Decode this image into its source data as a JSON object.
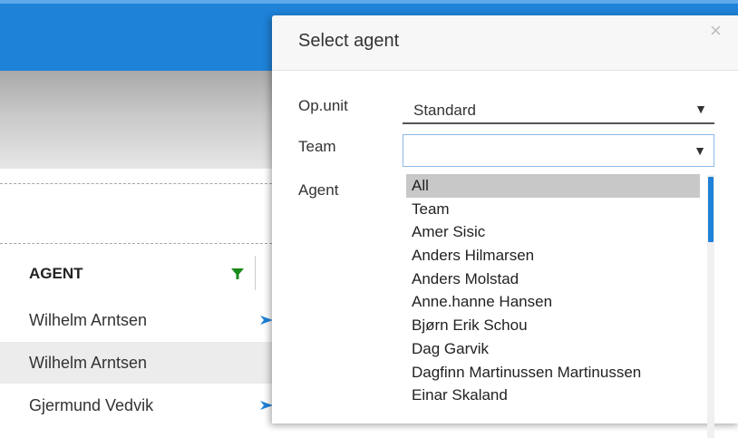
{
  "grid": {
    "column_header": "AGENT",
    "rows": [
      "Wilhelm Arntsen",
      "Wilhelm Arntsen",
      "Gjermund Vedvik"
    ]
  },
  "dialog": {
    "title": "Select agent",
    "close_symbol": "×",
    "fields": {
      "opunit_label": "Op.unit",
      "opunit_value": "Standard",
      "team_label": "Team",
      "team_value": "",
      "agent_label": "Agent"
    },
    "dropdown_arrow": "▼",
    "agent_list": [
      "All",
      "Team",
      "Amer Sisic",
      "Anders Hilmarsen",
      "Anders Molstad",
      "Anne.hanne Hansen",
      "Bjørn Erik Schou",
      "Dag Garvik",
      "Dagfinn Martinussen Martinussen",
      "Einar Skaland"
    ],
    "selected_index": 0
  },
  "colors": {
    "topbar": "#1e82d8",
    "accent": "#1e82d8",
    "filter": "#1a8a1a",
    "selected_row": "#c8c8c8"
  },
  "icons": [
    "filter-icon",
    "send-icon",
    "close-icon",
    "dropdown-arrow-icon"
  ]
}
